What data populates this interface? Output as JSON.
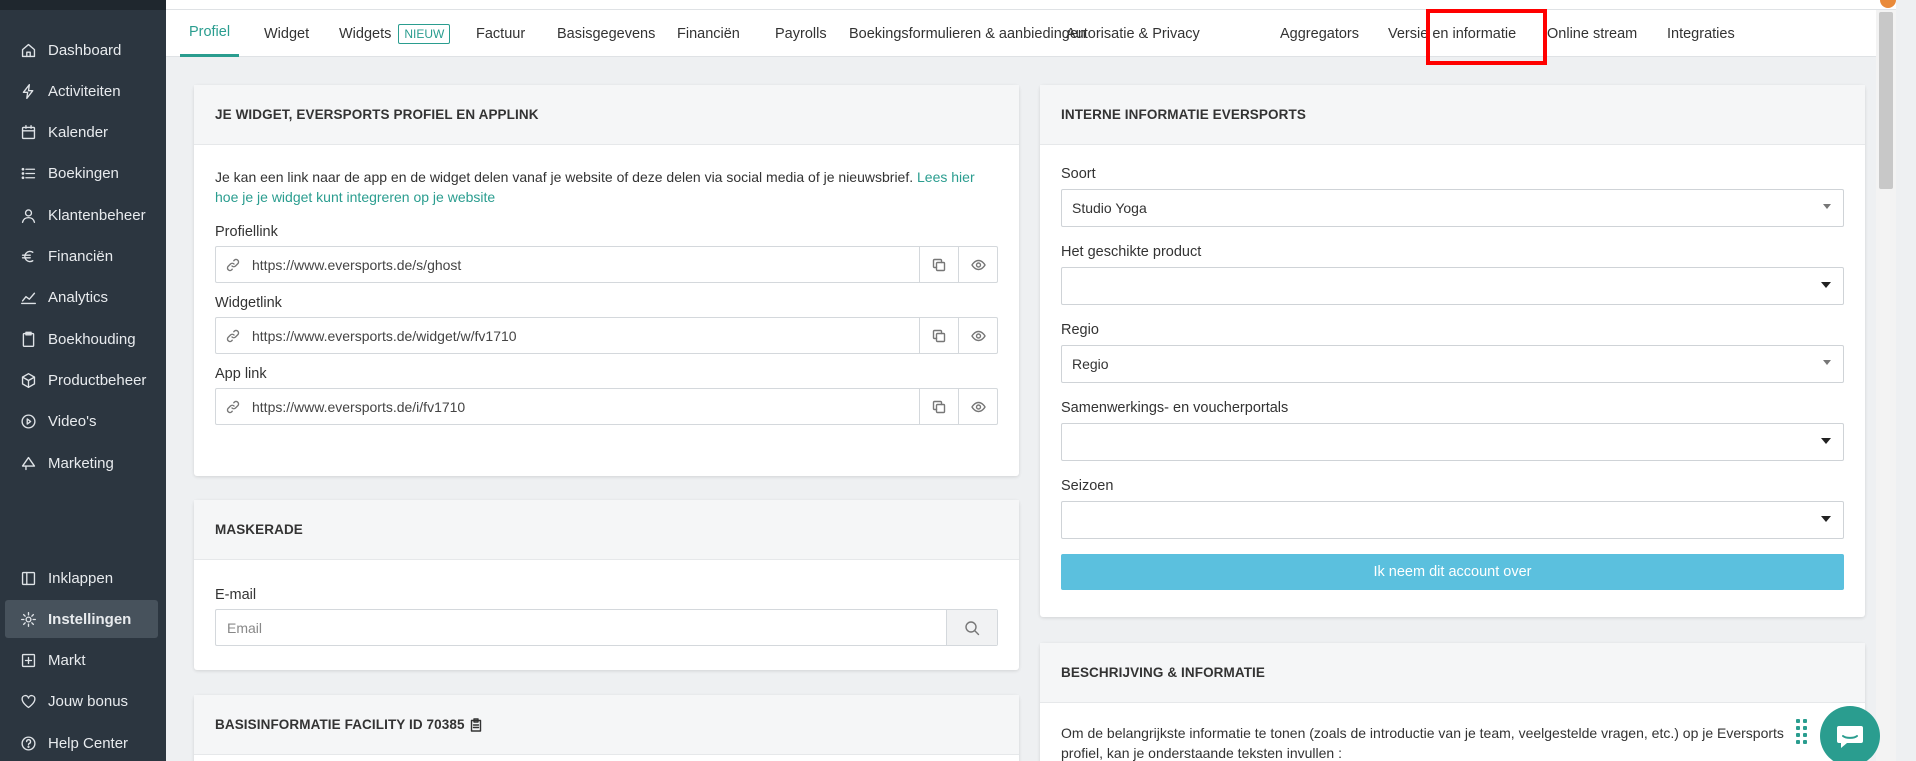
{
  "sidebar": {
    "items": [
      {
        "label": "Dashboard",
        "icon": "home-icon"
      },
      {
        "label": "Activiteiten",
        "icon": "activity-icon"
      },
      {
        "label": "Kalender",
        "icon": "calendar-icon"
      },
      {
        "label": "Boekingen",
        "icon": "list-icon"
      },
      {
        "label": "Klantenbeheer",
        "icon": "user-icon"
      },
      {
        "label": "Financiën",
        "icon": "euro-icon"
      },
      {
        "label": "Analytics",
        "icon": "chart-line-icon"
      },
      {
        "label": "Boekhouding",
        "icon": "clipboard-icon"
      },
      {
        "label": "Productbeheer",
        "icon": "box-icon"
      },
      {
        "label": "Video's",
        "icon": "play-circle-icon"
      },
      {
        "label": "Marketing",
        "icon": "megaphone-icon"
      }
    ],
    "bottom_items": [
      {
        "label": "Inklappen",
        "icon": "collapse-icon"
      },
      {
        "label": "Instellingen",
        "icon": "gear-icon",
        "active": true
      },
      {
        "label": "Markt",
        "icon": "plus-square-icon"
      },
      {
        "label": "Jouw bonus",
        "icon": "heart-icon"
      },
      {
        "label": "Help Center",
        "icon": "help-circle-icon"
      }
    ]
  },
  "tabs": [
    {
      "label": "Profiel",
      "active": true
    },
    {
      "label": "Widget"
    },
    {
      "label": "Widgets",
      "badge": "NIEUW"
    },
    {
      "label": "Factuur"
    },
    {
      "label": "Basisgegevens"
    },
    {
      "label": "Financiën"
    },
    {
      "label": "Payrolls"
    },
    {
      "label": "Boekingsformulieren & aanbiedingen"
    },
    {
      "label": "Autorisatie & Privacy"
    },
    {
      "label": "Aggregators",
      "highlighted": true
    },
    {
      "label": "Versie en informatie"
    },
    {
      "label": "Online stream"
    },
    {
      "label": "Integraties"
    }
  ],
  "widget_card": {
    "title": "JE WIDGET, EVERSPORTS PROFIEL EN APPLINK",
    "description": "Je kan een link naar de app en de widget delen vanaf je website of deze delen via social media of je nieuwsbrief.",
    "link_text": "Lees hier hoe je je widget kunt integreren op je website",
    "fields": [
      {
        "label": "Profiellink",
        "value": "https://www.eversports.de/s/ghost"
      },
      {
        "label": "Widgetlink",
        "value": "https://www.eversports.de/widget/w/fv1710"
      },
      {
        "label": "App link",
        "value": "https://www.eversports.de/i/fv1710"
      }
    ]
  },
  "maskerade_card": {
    "title": "MASKERADE",
    "email_label": "E-mail",
    "email_placeholder": "Email"
  },
  "basis_card": {
    "title": "BASISINFORMATIE FACILITY ID 70385"
  },
  "interne_card": {
    "title": "INTERNE INFORMATIE EVERSPORTS",
    "fields": [
      {
        "label": "Soort",
        "value": "Studio Yoga"
      },
      {
        "label": "Het geschikte product",
        "value": ""
      },
      {
        "label": "Regio",
        "value": "Regio"
      },
      {
        "label": "Samenwerkings- en voucherportals",
        "value": ""
      },
      {
        "label": "Seizoen",
        "value": ""
      }
    ],
    "button_label": "Ik neem dit account over"
  },
  "beschrijving_card": {
    "title": "BESCHRIJVING & INFORMATIE",
    "text": "Om de belangrijkste informatie te tonen (zoals de introductie van je team, veelgestelde vragen, etc.) op je Eversports profiel, kan je onderstaande teksten invullen :"
  },
  "colors": {
    "accent": "#2a9d8f",
    "sidebar": "#2c3640",
    "primary_button": "#5bc0de",
    "highlight": "#ff0000"
  }
}
